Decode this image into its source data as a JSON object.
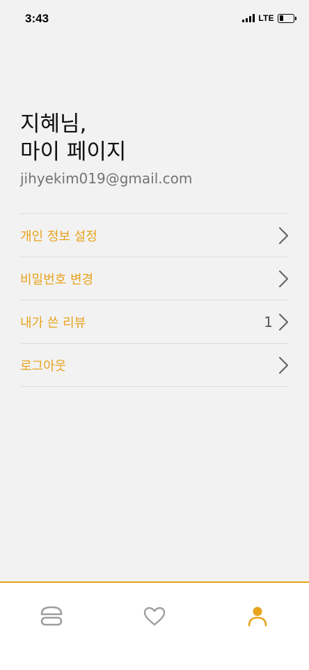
{
  "status_bar": {
    "time": "3:43",
    "network": "LTE",
    "battery_level": 0.3,
    "signal_bars": 4
  },
  "profile": {
    "greeting_line1": "지혜님,",
    "greeting_line2": "마이 페이지",
    "email": "jihyekim019@gmail.com"
  },
  "menu": {
    "items": [
      {
        "label": "개인 정보 설정"
      },
      {
        "label": "비밀번호 변경"
      },
      {
        "label": "내가 쓴 리뷰",
        "count": "1"
      },
      {
        "label": "로그아웃"
      }
    ]
  },
  "tab_bar": {
    "items": [
      {
        "icon": "burger-icon",
        "active": false
      },
      {
        "icon": "heart-icon",
        "active": false
      },
      {
        "icon": "person-icon",
        "active": true
      }
    ]
  },
  "colors": {
    "accent": "#e8a21b",
    "background": "#f2f2f2",
    "inactive_icon": "#9e9e9e"
  }
}
